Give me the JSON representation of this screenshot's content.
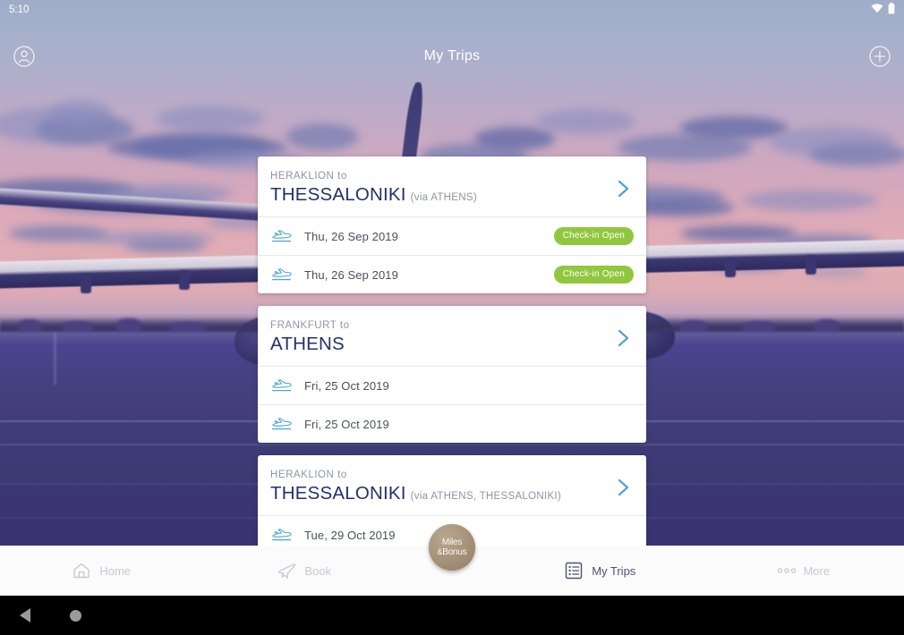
{
  "status_bar": {
    "time": "5:10",
    "wifi_icon": "wifi-icon",
    "battery_icon": "battery-icon"
  },
  "header": {
    "title": "My Trips",
    "profile_icon": "profile-circle-icon",
    "add_icon": "plus-circle-icon"
  },
  "colors": {
    "accent_navy": "#23306b",
    "chevron_blue": "#4fa3d1",
    "badge_green": "#91c73e",
    "muted_gray": "#8f94a3",
    "miles_gold": "#a59178"
  },
  "trips": [
    {
      "from_label": "HERAKLION to",
      "destination": "THESSALONIKI",
      "via": "(via ATHENS)",
      "chevron_icon": "chevron-right-icon",
      "flights": [
        {
          "icon": "plane-departure-icon",
          "date": "Thu, 26 Sep 2019",
          "badge": "Check-in Open"
        },
        {
          "icon": "plane-departure-icon",
          "date": "Thu, 26 Sep 2019",
          "badge": "Check-in Open"
        }
      ]
    },
    {
      "from_label": "FRANKFURT to",
      "destination": "ATHENS",
      "via": "",
      "chevron_icon": "chevron-right-icon",
      "flights": [
        {
          "icon": "plane-departure-icon",
          "date": "Fri, 25 Oct 2019",
          "badge": ""
        },
        {
          "icon": "plane-departure-icon",
          "date": "Fri, 25 Oct 2019",
          "badge": ""
        }
      ]
    },
    {
      "from_label": "HERAKLION to",
      "destination": "THESSALONIKI",
      "via": "(via ATHENS, THESSALONIKI)",
      "chevron_icon": "chevron-right-icon",
      "flights": [
        {
          "icon": "plane-departure-icon",
          "date": "Tue, 29 Oct 2019",
          "badge": ""
        }
      ]
    }
  ],
  "tabbar": {
    "items": [
      {
        "label": "Home",
        "icon": "home-icon",
        "active": false
      },
      {
        "label": "Book",
        "icon": "airplane-icon",
        "active": false
      },
      {
        "label": "My Trips",
        "icon": "list-icon",
        "active": true
      },
      {
        "label": "More",
        "icon": "ellipsis-icon",
        "active": false
      }
    ],
    "miles_button": {
      "line1": "Miles",
      "line2": "Bonus",
      "amp": "&"
    }
  },
  "android_nav": {
    "back_icon": "android-back-icon",
    "home_icon": "android-home-icon"
  }
}
